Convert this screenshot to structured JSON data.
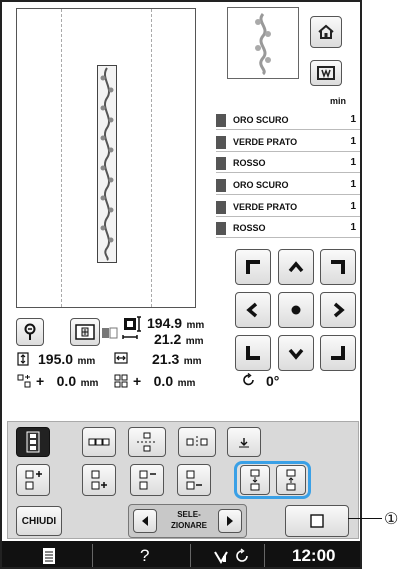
{
  "thread_table": {
    "min_header": "min",
    "rows": [
      {
        "name": "ORO SCURO",
        "count": "1"
      },
      {
        "name": "VERDE PRATO",
        "count": "1"
      },
      {
        "name": "ROSSO",
        "count": "1"
      },
      {
        "name": "ORO SCURO",
        "count": "1"
      },
      {
        "name": "VERDE PRATO",
        "count": "1"
      },
      {
        "name": "ROSSO",
        "count": "1"
      }
    ]
  },
  "size": {
    "height": "194.9",
    "height_unit": "mm",
    "width": "21.2",
    "width_unit": "mm"
  },
  "pattern_size": {
    "v_value": "195.0",
    "v_unit": "mm",
    "h_value": "21.3",
    "h_unit": "mm"
  },
  "offset": {
    "x_prefix": "+",
    "x_value": "0.0",
    "x_unit": "mm",
    "y_prefix": "+",
    "y_value": "0.0",
    "y_unit": "mm",
    "angle_value": "0",
    "angle_unit": "°"
  },
  "buttons": {
    "close_label": "CHIUDI",
    "select_label_1": "SELE-",
    "select_label_2": "ZIONARE"
  },
  "status_bar": {
    "help_label": "?",
    "time": "12:00"
  },
  "callout": {
    "label": "①"
  },
  "icons": [
    "home-icon",
    "embroidery-frame-icon",
    "zoom-icon",
    "thread-color-icon",
    "pattern-size-icon",
    "arrow-up-icon",
    "arrow-down-icon",
    "arrow-left-icon",
    "arrow-right-icon",
    "center-icon",
    "document-icon",
    "wifi-icon",
    "refresh-icon"
  ]
}
